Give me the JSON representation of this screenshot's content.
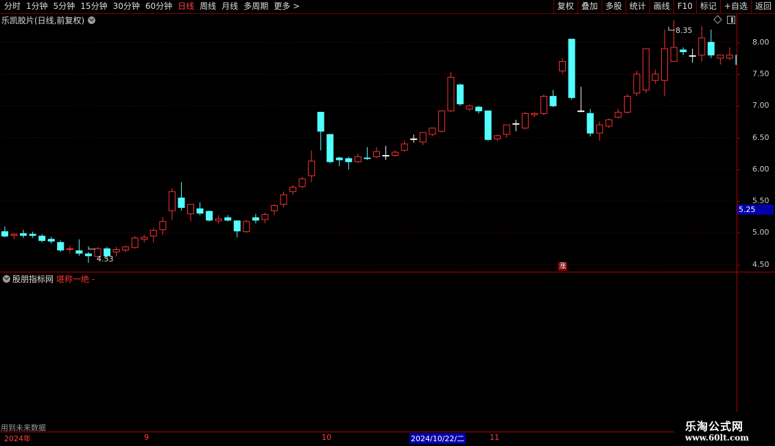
{
  "toolbar": {
    "periods": [
      "分时",
      "1分钟",
      "5分钟",
      "15分钟",
      "30分钟",
      "60分钟",
      "日线",
      "周线",
      "月线",
      "多周期",
      "更多 >"
    ],
    "active_period": "日线",
    "right_buttons": [
      "复权",
      "叠加",
      "多股",
      "统计",
      "画线",
      "F10",
      "标记",
      "+自选",
      "返回"
    ]
  },
  "chart_title": "乐凯胶片(日线,前复权)",
  "price_axis": [
    "8.00",
    "7.50",
    "7.00",
    "6.50",
    "6.00",
    "5.50",
    "5.00",
    "4.50"
  ],
  "current_price": "5.25",
  "annotations": {
    "high": "8.35",
    "low": "4.53",
    "badge": "涨"
  },
  "indicator": {
    "name": "股朋指标网",
    "formula": "堪称一绝 -"
  },
  "bottom_note": "用到未来数据",
  "date_axis": {
    "year": "2024年",
    "m9": "9",
    "m10": "10",
    "current_date": "2024/10/22/二",
    "m11": "11"
  },
  "watermark": {
    "line1": "乐淘公式网",
    "line2": "www.60lt.com"
  },
  "colors": {
    "up": "#ff3232",
    "down": "#54ffff",
    "grid": "#7a0000",
    "axis": "#b00000"
  },
  "chart_data": {
    "type": "candlestick",
    "ylim": [
      4.4,
      8.45
    ],
    "candles": [
      [
        5.02,
        4.95,
        5.1,
        4.93
      ],
      [
        4.96,
        4.98,
        5.0,
        4.9
      ],
      [
        4.99,
        4.96,
        5.05,
        4.92
      ],
      [
        4.98,
        4.96,
        5.02,
        4.92
      ],
      [
        4.95,
        4.88,
        4.98,
        4.85
      ],
      [
        4.9,
        4.87,
        4.94,
        4.83
      ],
      [
        4.85,
        4.73,
        4.88,
        4.7
      ],
      [
        4.74,
        4.75,
        4.8,
        4.68
      ],
      [
        4.72,
        4.68,
        4.9,
        4.64
      ],
      [
        4.67,
        4.64,
        4.7,
        4.53
      ],
      [
        4.63,
        4.75,
        4.78,
        4.6
      ],
      [
        4.75,
        4.64,
        4.78,
        4.6
      ],
      [
        4.7,
        4.74,
        4.78,
        4.63
      ],
      [
        4.73,
        4.78,
        4.8,
        4.7
      ],
      [
        4.77,
        4.92,
        4.95,
        4.75
      ],
      [
        4.9,
        4.93,
        4.97,
        4.85
      ],
      [
        4.95,
        5.04,
        5.08,
        4.85
      ],
      [
        5.05,
        5.18,
        5.25,
        4.97
      ],
      [
        5.35,
        5.65,
        5.7,
        5.2
      ],
      [
        5.55,
        5.4,
        5.8,
        5.35
      ],
      [
        5.3,
        5.45,
        5.45,
        5.18
      ],
      [
        5.38,
        5.31,
        5.48,
        5.28
      ],
      [
        5.34,
        5.2,
        5.35,
        5.18
      ],
      [
        5.19,
        5.22,
        5.28,
        5.15
      ],
      [
        5.24,
        5.2,
        5.28,
        5.18
      ],
      [
        5.19,
        5.03,
        5.2,
        4.93
      ],
      [
        5.02,
        5.18,
        5.2,
        5.0
      ],
      [
        5.24,
        5.2,
        5.3,
        5.15
      ],
      [
        5.21,
        5.29,
        5.32,
        5.15
      ],
      [
        5.35,
        5.43,
        5.45,
        5.28
      ],
      [
        5.45,
        5.6,
        5.65,
        5.4
      ],
      [
        5.65,
        5.72,
        5.75,
        5.6
      ],
      [
        5.73,
        5.85,
        5.88,
        5.7
      ],
      [
        5.9,
        6.13,
        6.3,
        5.8
      ],
      [
        6.9,
        6.6,
        6.9,
        6.3
      ],
      [
        6.55,
        6.12,
        6.55,
        6.1
      ],
      [
        6.18,
        6.15,
        6.2,
        6.05
      ],
      [
        6.17,
        6.12,
        6.2,
        6.0
      ],
      [
        6.12,
        6.2,
        6.25,
        6.1
      ],
      [
        6.18,
        6.17,
        6.35,
        6.15
      ],
      [
        6.2,
        6.28,
        6.35,
        6.18
      ],
      [
        6.22,
        6.22,
        6.37,
        6.15
      ],
      [
        6.22,
        6.27,
        6.3,
        6.2
      ],
      [
        6.3,
        6.4,
        6.45,
        6.28
      ],
      [
        6.48,
        6.48,
        6.55,
        6.42
      ],
      [
        6.43,
        6.58,
        6.58,
        6.38
      ],
      [
        6.55,
        6.65,
        6.65,
        6.52
      ],
      [
        6.6,
        6.92,
        6.93,
        6.58
      ],
      [
        6.92,
        7.45,
        7.53,
        6.9
      ],
      [
        7.33,
        7.03,
        7.35,
        7.0
      ],
      [
        6.95,
        7.0,
        7.02,
        6.92
      ],
      [
        6.98,
        6.92,
        7.0,
        6.88
      ],
      [
        6.92,
        6.47,
        6.93,
        6.45
      ],
      [
        6.48,
        6.53,
        6.55,
        6.45
      ],
      [
        6.55,
        6.7,
        6.7,
        6.5
      ],
      [
        6.72,
        6.72,
        6.78,
        6.6
      ],
      [
        6.65,
        6.88,
        6.9,
        6.63
      ],
      [
        6.86,
        6.88,
        6.9,
        6.82
      ],
      [
        6.88,
        7.15,
        7.18,
        6.85
      ],
      [
        7.15,
        7.0,
        7.25,
        6.98
      ],
      [
        7.55,
        7.7,
        7.75,
        7.5
      ],
      [
        8.05,
        7.13,
        8.05,
        7.1
      ],
      [
        6.92,
        6.92,
        7.3,
        6.9
      ],
      [
        6.88,
        6.57,
        6.95,
        6.52
      ],
      [
        6.57,
        6.7,
        6.75,
        6.45
      ],
      [
        6.68,
        6.78,
        6.8,
        6.65
      ],
      [
        6.82,
        6.9,
        6.95,
        6.8
      ],
      [
        6.9,
        7.15,
        7.18,
        6.88
      ],
      [
        7.2,
        7.5,
        7.55,
        7.15
      ],
      [
        7.25,
        7.9,
        7.9,
        7.2
      ],
      [
        7.4,
        7.5,
        7.57,
        7.35
      ],
      [
        7.4,
        7.9,
        8.2,
        7.15
      ],
      [
        7.7,
        7.92,
        8.35,
        7.7
      ],
      [
        7.88,
        7.85,
        7.92,
        7.8
      ],
      [
        7.79,
        7.79,
        7.9,
        7.68
      ],
      [
        7.8,
        8.07,
        8.25,
        7.7
      ],
      [
        8.0,
        7.8,
        8.2,
        7.75
      ],
      [
        7.75,
        7.8,
        7.8,
        7.65
      ],
      [
        7.75,
        7.8,
        7.92,
        7.72
      ],
      [
        7.8,
        7.65,
        7.83,
        7.55
      ]
    ]
  }
}
